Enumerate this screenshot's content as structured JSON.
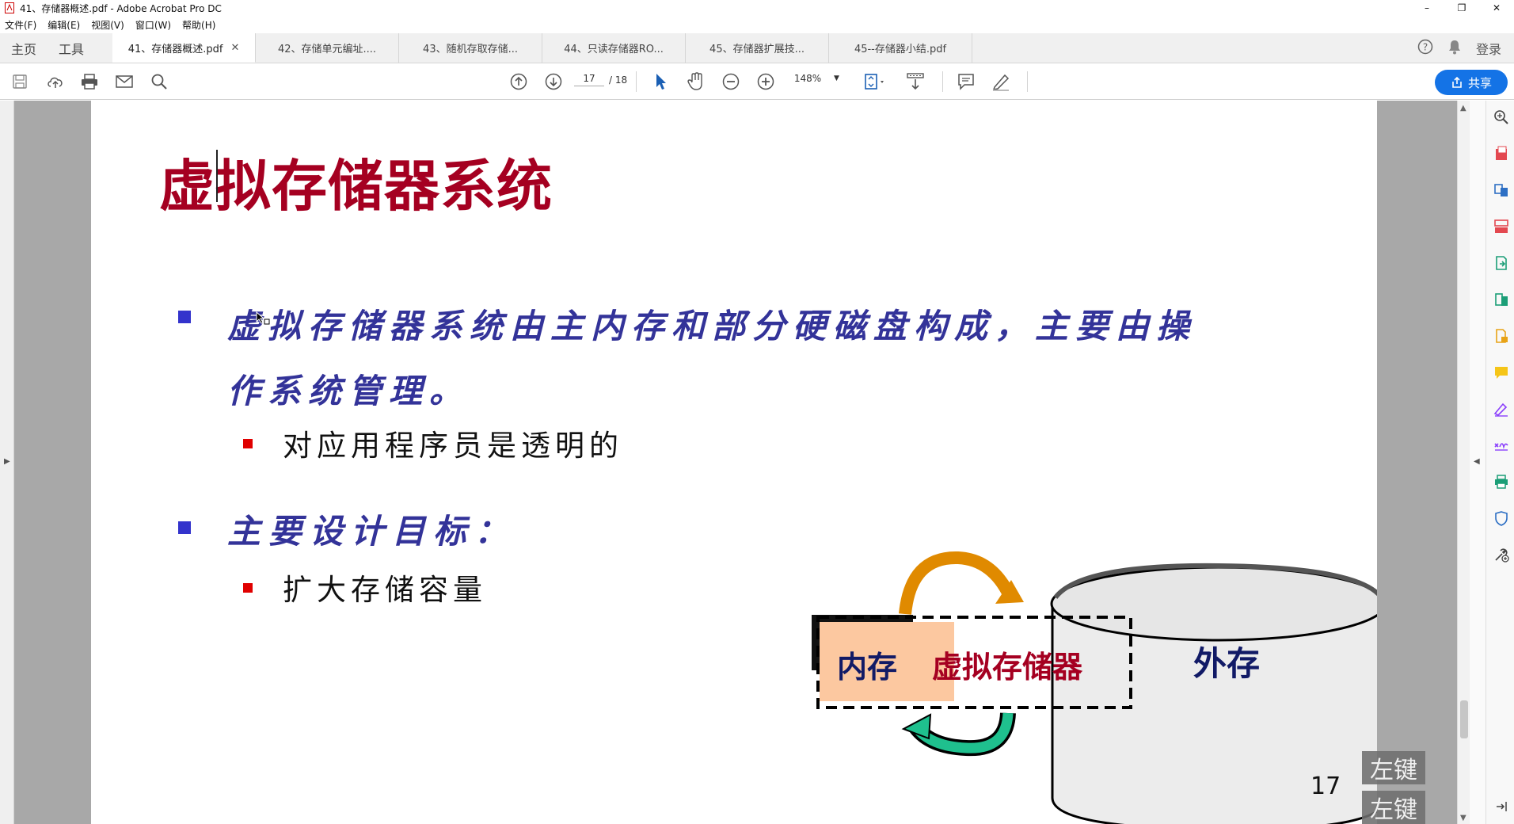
{
  "window": {
    "title": "41、存储器概述.pdf - Adobe Acrobat Pro DC",
    "controls": [
      "–",
      "❐",
      "✕"
    ]
  },
  "menu": [
    "文件(F)",
    "编辑(E)",
    "视图(V)",
    "窗口(W)",
    "帮助(H)"
  ],
  "nav_tabs": [
    "主页",
    "工具"
  ],
  "doc_tabs": [
    {
      "label": "41、存储器概述.pdf",
      "active": true
    },
    {
      "label": "42、存储单元编址....",
      "active": false
    },
    {
      "label": "43、随机存取存储...",
      "active": false
    },
    {
      "label": "44、只读存储器RO...",
      "active": false
    },
    {
      "label": "45、存储器扩展技...",
      "active": false
    },
    {
      "label": "45--存储器小结.pdf",
      "active": false
    }
  ],
  "tab_close": "✕",
  "header_right": {
    "help": "?",
    "bell": "🔔",
    "login": "登录"
  },
  "toolbar": {
    "page_current": "17",
    "page_total": "/ 18",
    "zoom": "148%",
    "share_label": "共享"
  },
  "slide": {
    "title": "虚拟存储器系统",
    "bullet1_line1": "虚拟存储器系统由主内存和部分硬磁盘构成，主要由操",
    "bullet1_line2": "作系统管理。",
    "sub1": "对应用程序员是透明的",
    "bullet2": "主要设计目标：",
    "sub2": "扩大存储容量",
    "diagram": {
      "main_memory": "内存",
      "virtual_storage": "虚拟存储器",
      "external_storage": "外存"
    },
    "page_number": "17"
  },
  "key_tips": [
    "左键",
    "左键"
  ],
  "colors": {
    "title_red": "#a50021",
    "bullet_blue": "#333399",
    "share_blue": "#1473e6",
    "orange_arrow": "#e08a00",
    "green_arrow": "#1fc08e",
    "memory_fill": "#fcc8a0"
  }
}
